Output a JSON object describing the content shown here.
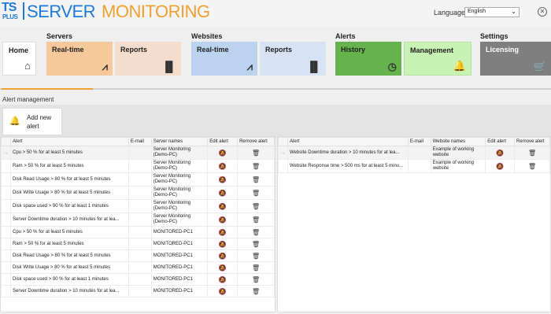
{
  "header": {
    "logo": {
      "ts": "TS",
      "plus": "PLUS",
      "name_part1": "SERVER",
      "name_part2": "MONITORING"
    },
    "language_label": "Language",
    "language_value": "English"
  },
  "nav": {
    "groups": {
      "servers": "Servers",
      "websites": "Websites",
      "alerts": "Alerts",
      "settings": "Settings"
    },
    "tiles": {
      "home": "Home",
      "srv_realtime": "Real-time",
      "srv_reports": "Reports",
      "web_realtime": "Real-time",
      "web_reports": "Reports",
      "history": "History",
      "management": "Management",
      "licensing": "Licensing"
    }
  },
  "section_title": "Alert management",
  "add_button": {
    "line1": "Add new",
    "line2": "alert"
  },
  "server_table": {
    "columns": [
      "Alert",
      "E-mail",
      "Server names",
      "Edit alert",
      "Remove alert"
    ],
    "rows": [
      {
        "alert": "Cpu > 50 % for at least 5 minutes",
        "email": "",
        "server": "Server Monitoring (Demo-PC)"
      },
      {
        "alert": "Ram > 50 % for at least 5 minutes",
        "email": "",
        "server": "Server Monitoring (Demo-PC)"
      },
      {
        "alert": "Disk Read Usage > 80 % for at least 5 minutes",
        "email": "",
        "server": "Server Monitoring (Demo-PC)"
      },
      {
        "alert": "Disk Write Usage > 80 % for at least 5 minutes",
        "email": "",
        "server": "Server Monitoring (Demo-PC)"
      },
      {
        "alert": "Disk space used > 90 % for at least 1 minutes",
        "email": "",
        "server": "Server Monitoring (Demo-PC)"
      },
      {
        "alert": "Server Downtime duration > 10 minutes for at lea...",
        "email": "",
        "server": "Server Monitoring (Demo-PC)"
      },
      {
        "alert": "Cpu > 50 % for at least 5 minutes",
        "email": "",
        "server": "MONITORED-PC1"
      },
      {
        "alert": "Ram > 50 % for at least 5 minutes",
        "email": "",
        "server": "MONITORED-PC1"
      },
      {
        "alert": "Disk Read Usage > 80 % for at least 5 minutes",
        "email": "",
        "server": "MONITORED-PC1"
      },
      {
        "alert": "Disk Write Usage > 80 % for at least 5 minutes",
        "email": "",
        "server": "MONITORED-PC1"
      },
      {
        "alert": "Disk space used > 90 % for at least 1 minutes",
        "email": "",
        "server": "MONITORED-PC1"
      },
      {
        "alert": "Server Downtime duration > 10 minutes for at lea...",
        "email": "",
        "server": "MONITORED-PC1"
      }
    ]
  },
  "website_table": {
    "columns": [
      "Alert",
      "E-mail",
      "Website names",
      "Edit alert",
      "Remove alert"
    ],
    "rows": [
      {
        "alert": "Website Downtime duration > 10 minutes for at lea...",
        "email": "",
        "website": "Example of working website"
      },
      {
        "alert": "Website Response time > 500 ms for at least 5 minu...",
        "email": "",
        "website": "Example of working website"
      }
    ]
  },
  "colors": {
    "accent_orange": "#f0a030",
    "brand_blue": "#1e7ad6",
    "tile_servers": "#f7c99a",
    "tile_websites": "#bcd3ef",
    "tile_history": "#66b34e",
    "tile_management": "#c8f3b4",
    "tile_licensing": "#7f7f7f"
  }
}
